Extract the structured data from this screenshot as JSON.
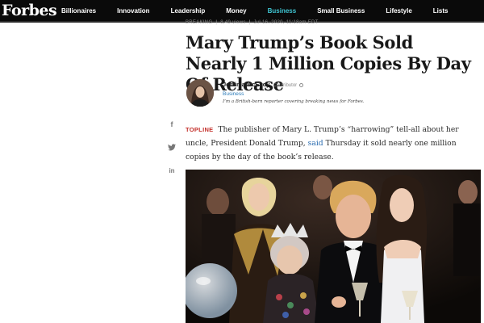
{
  "nav": {
    "logo": "Forbes",
    "items": [
      "Billionaires",
      "Innovation",
      "Leadership",
      "Money",
      "Business",
      "Small Business",
      "Lifestyle",
      "Lists"
    ],
    "active": "Business"
  },
  "breadcrumb": {
    "section": "BREAKING",
    "views": "8,49 views",
    "date": "Jul 16, 2020, 11:18am EDT"
  },
  "article": {
    "headline": "Mary Trump’s Book Sold Nearly 1 Million Copies By Day Of Release",
    "topline_label": "TOPLINE",
    "lede_part1": "The publisher of Mary L. Trump’s “harrowing” tell-all about her uncle, President Donald Trump,",
    "lede_link": "said",
    "lede_part2": "Thursday it sold nearly one million copies by the day of the book’s release."
  },
  "author": {
    "name": "Jemima McEvoy",
    "role": "Contributor",
    "section": "Business",
    "bio": "I’m a British-born reporter covering breaking news for Forbes."
  },
  "share": {
    "icons": [
      "facebook-icon",
      "twitter-icon",
      "linkedin-icon"
    ],
    "facebook_glyph": "f",
    "linkedin_glyph": "in"
  },
  "colors": {
    "nav_bg": "#0a0a0a",
    "active_nav": "#3fc5d2",
    "topline": "#c4302b",
    "link": "#2b6cb0"
  }
}
